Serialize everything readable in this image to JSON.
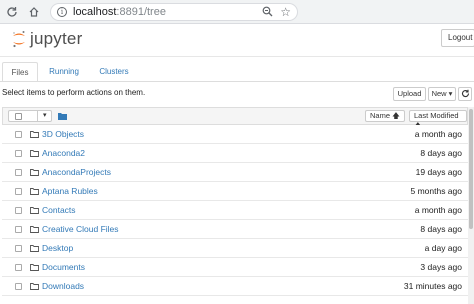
{
  "browser": {
    "url_host": "localhost",
    "url_path": ":8891/tree"
  },
  "header": {
    "logo_text": "jupyter",
    "logout_label": "Logout"
  },
  "tabs": [
    {
      "label": "Files"
    },
    {
      "label": "Running"
    },
    {
      "label": "Clusters"
    }
  ],
  "toolbar": {
    "instructions": "Select items to perform actions on them.",
    "upload_label": "Upload",
    "new_label": "New ▾",
    "refresh_icon": "refresh-icon"
  },
  "list": {
    "name_sort_label": "Name 🡅",
    "modified_sort_label": "Last Modified 🡅",
    "items": [
      {
        "name": "3D Objects",
        "modified": "a month ago"
      },
      {
        "name": "Anaconda2",
        "modified": "8 days ago"
      },
      {
        "name": "AnacondaProjects",
        "modified": "19 days ago"
      },
      {
        "name": "Aptana Rubles",
        "modified": "5 months ago"
      },
      {
        "name": "Contacts",
        "modified": "a month ago"
      },
      {
        "name": "Creative Cloud Files",
        "modified": "8 days ago"
      },
      {
        "name": "Desktop",
        "modified": "a day ago"
      },
      {
        "name": "Documents",
        "modified": "3 days ago"
      },
      {
        "name": "Downloads",
        "modified": "31 minutes ago"
      }
    ]
  },
  "colors": {
    "link": "#337ab7",
    "logo_orange": "#f37626"
  }
}
